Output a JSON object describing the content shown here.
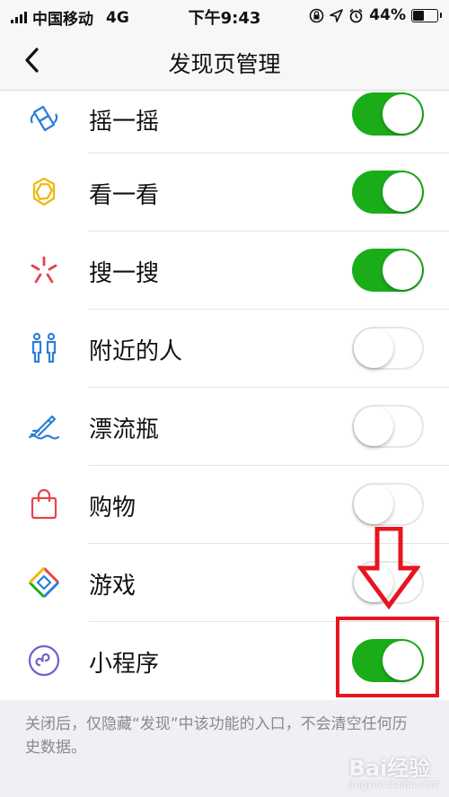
{
  "status_bar": {
    "carrier": "中国移动",
    "network": "4G",
    "time": "下午9:43",
    "battery_percent": "44%",
    "battery_level": 0.44
  },
  "nav": {
    "title": "发现页管理",
    "back_icon": "chevron-left-icon"
  },
  "items": [
    {
      "label": "摇一摇",
      "icon": "shake-icon",
      "enabled": true
    },
    {
      "label": "看一看",
      "icon": "top-stories-icon",
      "enabled": true
    },
    {
      "label": "搜一搜",
      "icon": "search-sparkle-icon",
      "enabled": true
    },
    {
      "label": "附近的人",
      "icon": "people-nearby-icon",
      "enabled": false
    },
    {
      "label": "漂流瓶",
      "icon": "drift-bottle-icon",
      "enabled": false
    },
    {
      "label": "购物",
      "icon": "shopping-bag-icon",
      "enabled": false
    },
    {
      "label": "游戏",
      "icon": "games-icon",
      "enabled": false
    },
    {
      "label": "小程序",
      "icon": "mini-program-icon",
      "enabled": true
    }
  ],
  "footer_note": "关闭后，仅隐藏“发现”中该功能的入口，不会清空任何历史数据。",
  "watermark": {
    "text": "Bai经验",
    "sub": "jingyan.baidu.com"
  },
  "colors": {
    "toggle_on": "#1aad19",
    "annotation": "#e8141f",
    "background": "#efeff4"
  }
}
